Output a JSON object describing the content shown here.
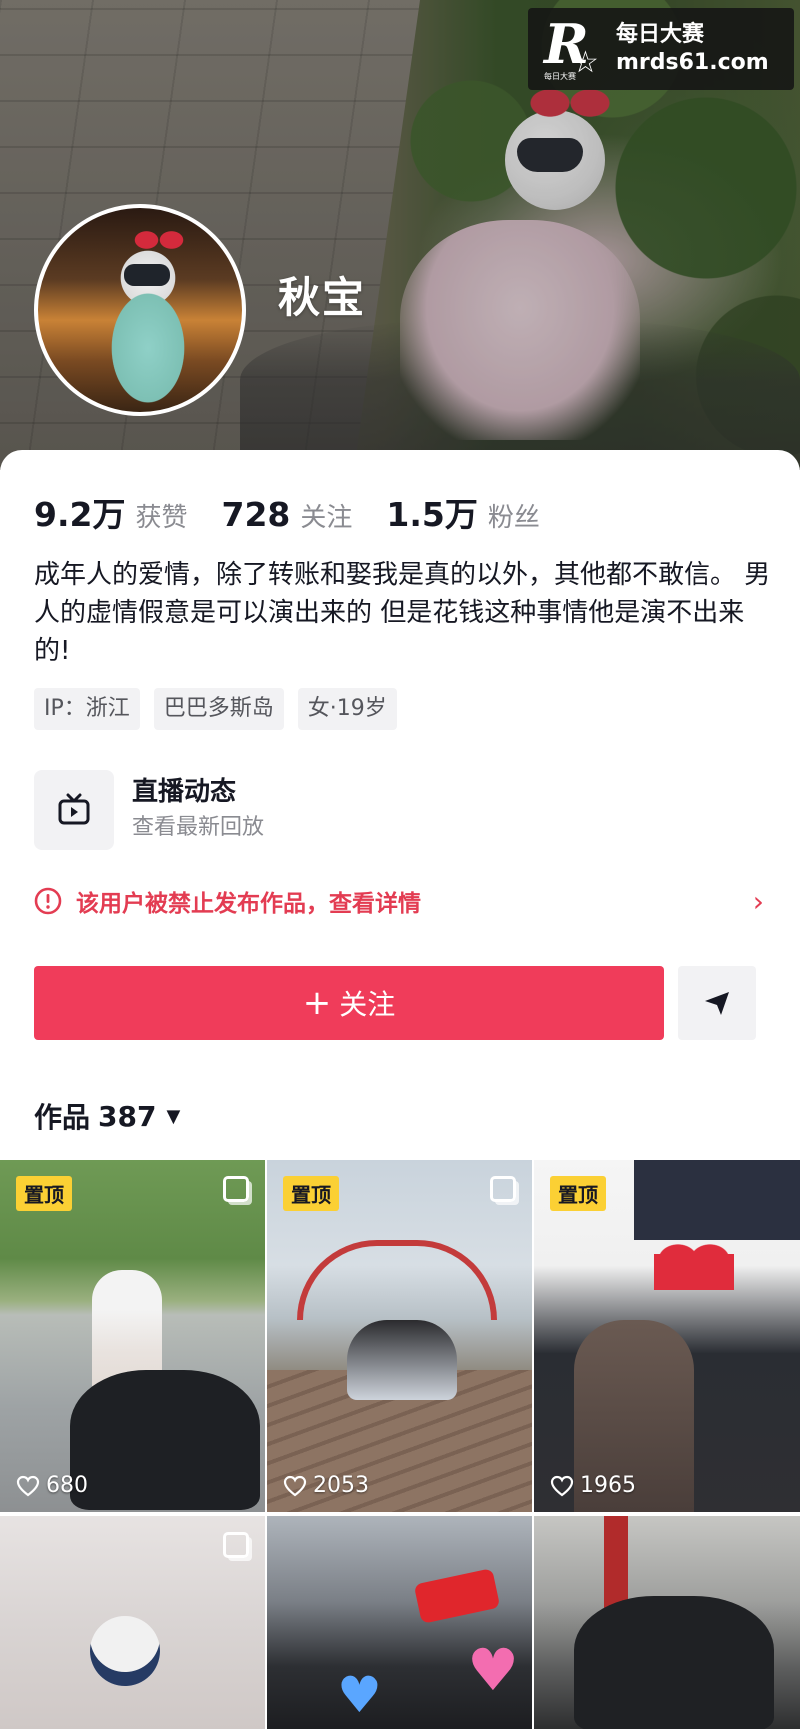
{
  "watermark": {
    "line1": "每日大赛",
    "line2": "mrds61.com",
    "logo_letter": "R",
    "logo_small": "每日大赛"
  },
  "profile": {
    "name": "秋宝"
  },
  "stats": [
    {
      "value": "9.2万",
      "label": "获赞"
    },
    {
      "value": "728",
      "label": "关注"
    },
    {
      "value": "1.5万",
      "label": "粉丝"
    }
  ],
  "bio": "成年人的爱情，除了转账和娶我是真的以外，其他都不敢信。 男人的虚情假意是可以演出来的 但是花钱这种事情他是演不出来的!",
  "tags": [
    "IP：浙江",
    "巴巴多斯岛",
    "女·19岁"
  ],
  "live": {
    "title": "直播动态",
    "subtitle": "查看最新回放",
    "icon": "tv-icon"
  },
  "notice": {
    "text": "该用户被禁止发布作品，查看详情",
    "icon": "alert-circle-icon",
    "color": "#e33c52"
  },
  "actions": {
    "follow_label": "关注",
    "follow_icon": "plus-icon",
    "share_icon": "send-icon",
    "accent": "#f03c5a"
  },
  "works": {
    "label": "作品",
    "count": "387"
  },
  "pin_label": "置顶",
  "grid": [
    {
      "pinned": true,
      "multi": true,
      "likes": "680"
    },
    {
      "pinned": true,
      "multi": true,
      "likes": "2053"
    },
    {
      "pinned": true,
      "multi": false,
      "likes": "1965"
    },
    {
      "pinned": false,
      "multi": true,
      "likes": ""
    },
    {
      "pinned": false,
      "multi": false,
      "likes": ""
    },
    {
      "pinned": false,
      "multi": false,
      "likes": ""
    }
  ]
}
